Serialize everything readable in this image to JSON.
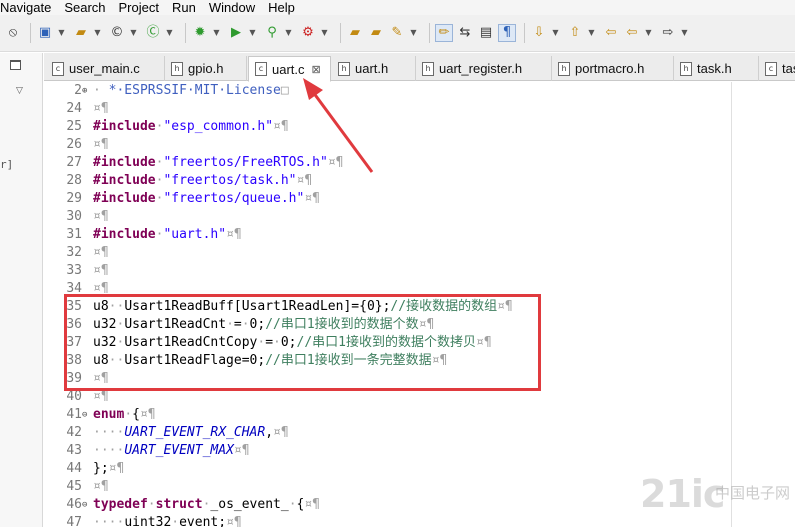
{
  "menu": [
    "Navigate",
    "Search",
    "Project",
    "Run",
    "Window",
    "Help"
  ],
  "tabs": [
    {
      "label": "user_main.c",
      "icon": "c-file-icon"
    },
    {
      "label": "gpio.h",
      "icon": "h-file-icon"
    },
    {
      "label": "uart.c",
      "icon": "c-file-icon",
      "active": true,
      "close": "⊠"
    },
    {
      "label": "uart.h",
      "icon": "h-file-icon"
    },
    {
      "label": "uart_register.h",
      "icon": "h-file-icon"
    },
    {
      "label": "portmacro.h",
      "icon": "h-file-icon"
    },
    {
      "label": "task.h",
      "icon": "h-file-icon"
    },
    {
      "label": "task",
      "icon": "c-file-icon"
    }
  ],
  "left_fragment": "r]",
  "lines": [
    {
      "n": "2",
      "fold": "+",
      "parts": [
        [
          "ws",
          "· "
        ],
        [
          "lic",
          "*·ESPRSSIF·MIT·License"
        ],
        [
          "ws",
          "□"
        ]
      ]
    },
    {
      "n": "24",
      "parts": [
        [
          "ws",
          "¤¶"
        ]
      ]
    },
    {
      "n": "25",
      "parts": [
        [
          "kw",
          "#include"
        ],
        [
          "ws",
          "·"
        ],
        [
          "str",
          "\"esp_common.h\""
        ],
        [
          "ws",
          "¤¶"
        ]
      ]
    },
    {
      "n": "26",
      "parts": [
        [
          "ws",
          "¤¶"
        ]
      ]
    },
    {
      "n": "27",
      "parts": [
        [
          "kw",
          "#include"
        ],
        [
          "ws",
          "·"
        ],
        [
          "str",
          "\"freertos/FreeRTOS.h\""
        ],
        [
          "ws",
          "¤¶"
        ]
      ]
    },
    {
      "n": "28",
      "parts": [
        [
          "kw",
          "#include"
        ],
        [
          "ws",
          "·"
        ],
        [
          "str",
          "\"freertos/task.h\""
        ],
        [
          "ws",
          "¤¶"
        ]
      ]
    },
    {
      "n": "29",
      "parts": [
        [
          "kw",
          "#include"
        ],
        [
          "ws",
          "·"
        ],
        [
          "str",
          "\"freertos/queue.h\""
        ],
        [
          "ws",
          "¤¶"
        ]
      ]
    },
    {
      "n": "30",
      "parts": [
        [
          "ws",
          "¤¶"
        ]
      ]
    },
    {
      "n": "31",
      "parts": [
        [
          "kw",
          "#include"
        ],
        [
          "ws",
          "·"
        ],
        [
          "str",
          "\"uart.h\""
        ],
        [
          "ws",
          "¤¶"
        ]
      ]
    },
    {
      "n": "32",
      "parts": [
        [
          "ws",
          "¤¶"
        ]
      ]
    },
    {
      "n": "33",
      "parts": [
        [
          "ws",
          "¤¶"
        ]
      ]
    },
    {
      "n": "34",
      "parts": [
        [
          "ws",
          "¤¶"
        ]
      ]
    },
    {
      "n": "35",
      "parts": [
        [
          "",
          "u8"
        ],
        [
          "ws",
          "··"
        ],
        [
          "",
          "Usart1ReadBuff[Usart1ReadLen]={0};"
        ],
        [
          "cm",
          "//接收数据的数组"
        ],
        [
          "ws",
          "¤¶"
        ]
      ]
    },
    {
      "n": "36",
      "parts": [
        [
          "",
          "u32"
        ],
        [
          "ws",
          "·"
        ],
        [
          "",
          "Usart1ReadCnt"
        ],
        [
          "ws",
          "·"
        ],
        [
          "",
          "="
        ],
        [
          "ws",
          "·"
        ],
        [
          "",
          "0;"
        ],
        [
          "cm",
          "//串口1接收到的数据个数"
        ],
        [
          "ws",
          "¤¶"
        ]
      ]
    },
    {
      "n": "37",
      "parts": [
        [
          "",
          "u32"
        ],
        [
          "ws",
          "·"
        ],
        [
          "",
          "Usart1ReadCntCopy"
        ],
        [
          "ws",
          "·"
        ],
        [
          "",
          "="
        ],
        [
          "ws",
          "·"
        ],
        [
          "",
          "0;"
        ],
        [
          "cm",
          "//串口1接收到的数据个数拷贝"
        ],
        [
          "ws",
          "¤¶"
        ]
      ]
    },
    {
      "n": "38",
      "parts": [
        [
          "",
          "u8"
        ],
        [
          "ws",
          "··"
        ],
        [
          "",
          "Usart1ReadFlage=0;"
        ],
        [
          "cm",
          "//串口1接收到一条完整数据"
        ],
        [
          "ws",
          "¤¶"
        ]
      ]
    },
    {
      "n": "39",
      "parts": [
        [
          "ws",
          "¤¶"
        ]
      ]
    },
    {
      "n": "40",
      "parts": [
        [
          "ws",
          "¤¶"
        ]
      ]
    },
    {
      "n": "41",
      "fold": "-",
      "parts": [
        [
          "kw",
          "enum"
        ],
        [
          "ws",
          "·"
        ],
        [
          "",
          "{"
        ],
        [
          "ws",
          "¤¶"
        ]
      ]
    },
    {
      "n": "42",
      "parts": [
        [
          "ws",
          "····"
        ],
        [
          "en",
          "UART_EVENT_RX_CHAR"
        ],
        [
          "",
          ","
        ],
        [
          "ws",
          "¤¶"
        ]
      ]
    },
    {
      "n": "43",
      "parts": [
        [
          "ws",
          "····"
        ],
        [
          "en",
          "UART_EVENT_MAX"
        ],
        [
          "ws",
          "¤¶"
        ]
      ]
    },
    {
      "n": "44",
      "parts": [
        [
          "",
          "};"
        ],
        [
          "ws",
          "¤¶"
        ]
      ]
    },
    {
      "n": "45",
      "parts": [
        [
          "ws",
          "¤¶"
        ]
      ]
    },
    {
      "n": "46",
      "fold": "-",
      "parts": [
        [
          "kw",
          "typedef"
        ],
        [
          "ws",
          "·"
        ],
        [
          "kw",
          "struct"
        ],
        [
          "ws",
          "·"
        ],
        [
          "",
          "_os_event_"
        ],
        [
          "ws",
          "·"
        ],
        [
          "",
          "{"
        ],
        [
          "ws",
          "¤¶"
        ]
      ]
    },
    {
      "n": "47",
      "parts": [
        [
          "ws",
          "····"
        ],
        [
          "",
          "uint32"
        ],
        [
          "ws",
          "·"
        ],
        [
          "",
          "event;"
        ],
        [
          "ws",
          "¤¶"
        ]
      ]
    }
  ],
  "watermark": {
    "main": "21ic",
    "small": "中国电子网"
  },
  "colors": {
    "highlight_box": "#e03a3e",
    "keyword": "#7f0055",
    "string": "#2a00ff",
    "comment": "#3f7f5f",
    "enum_constant": "#0000c0"
  }
}
